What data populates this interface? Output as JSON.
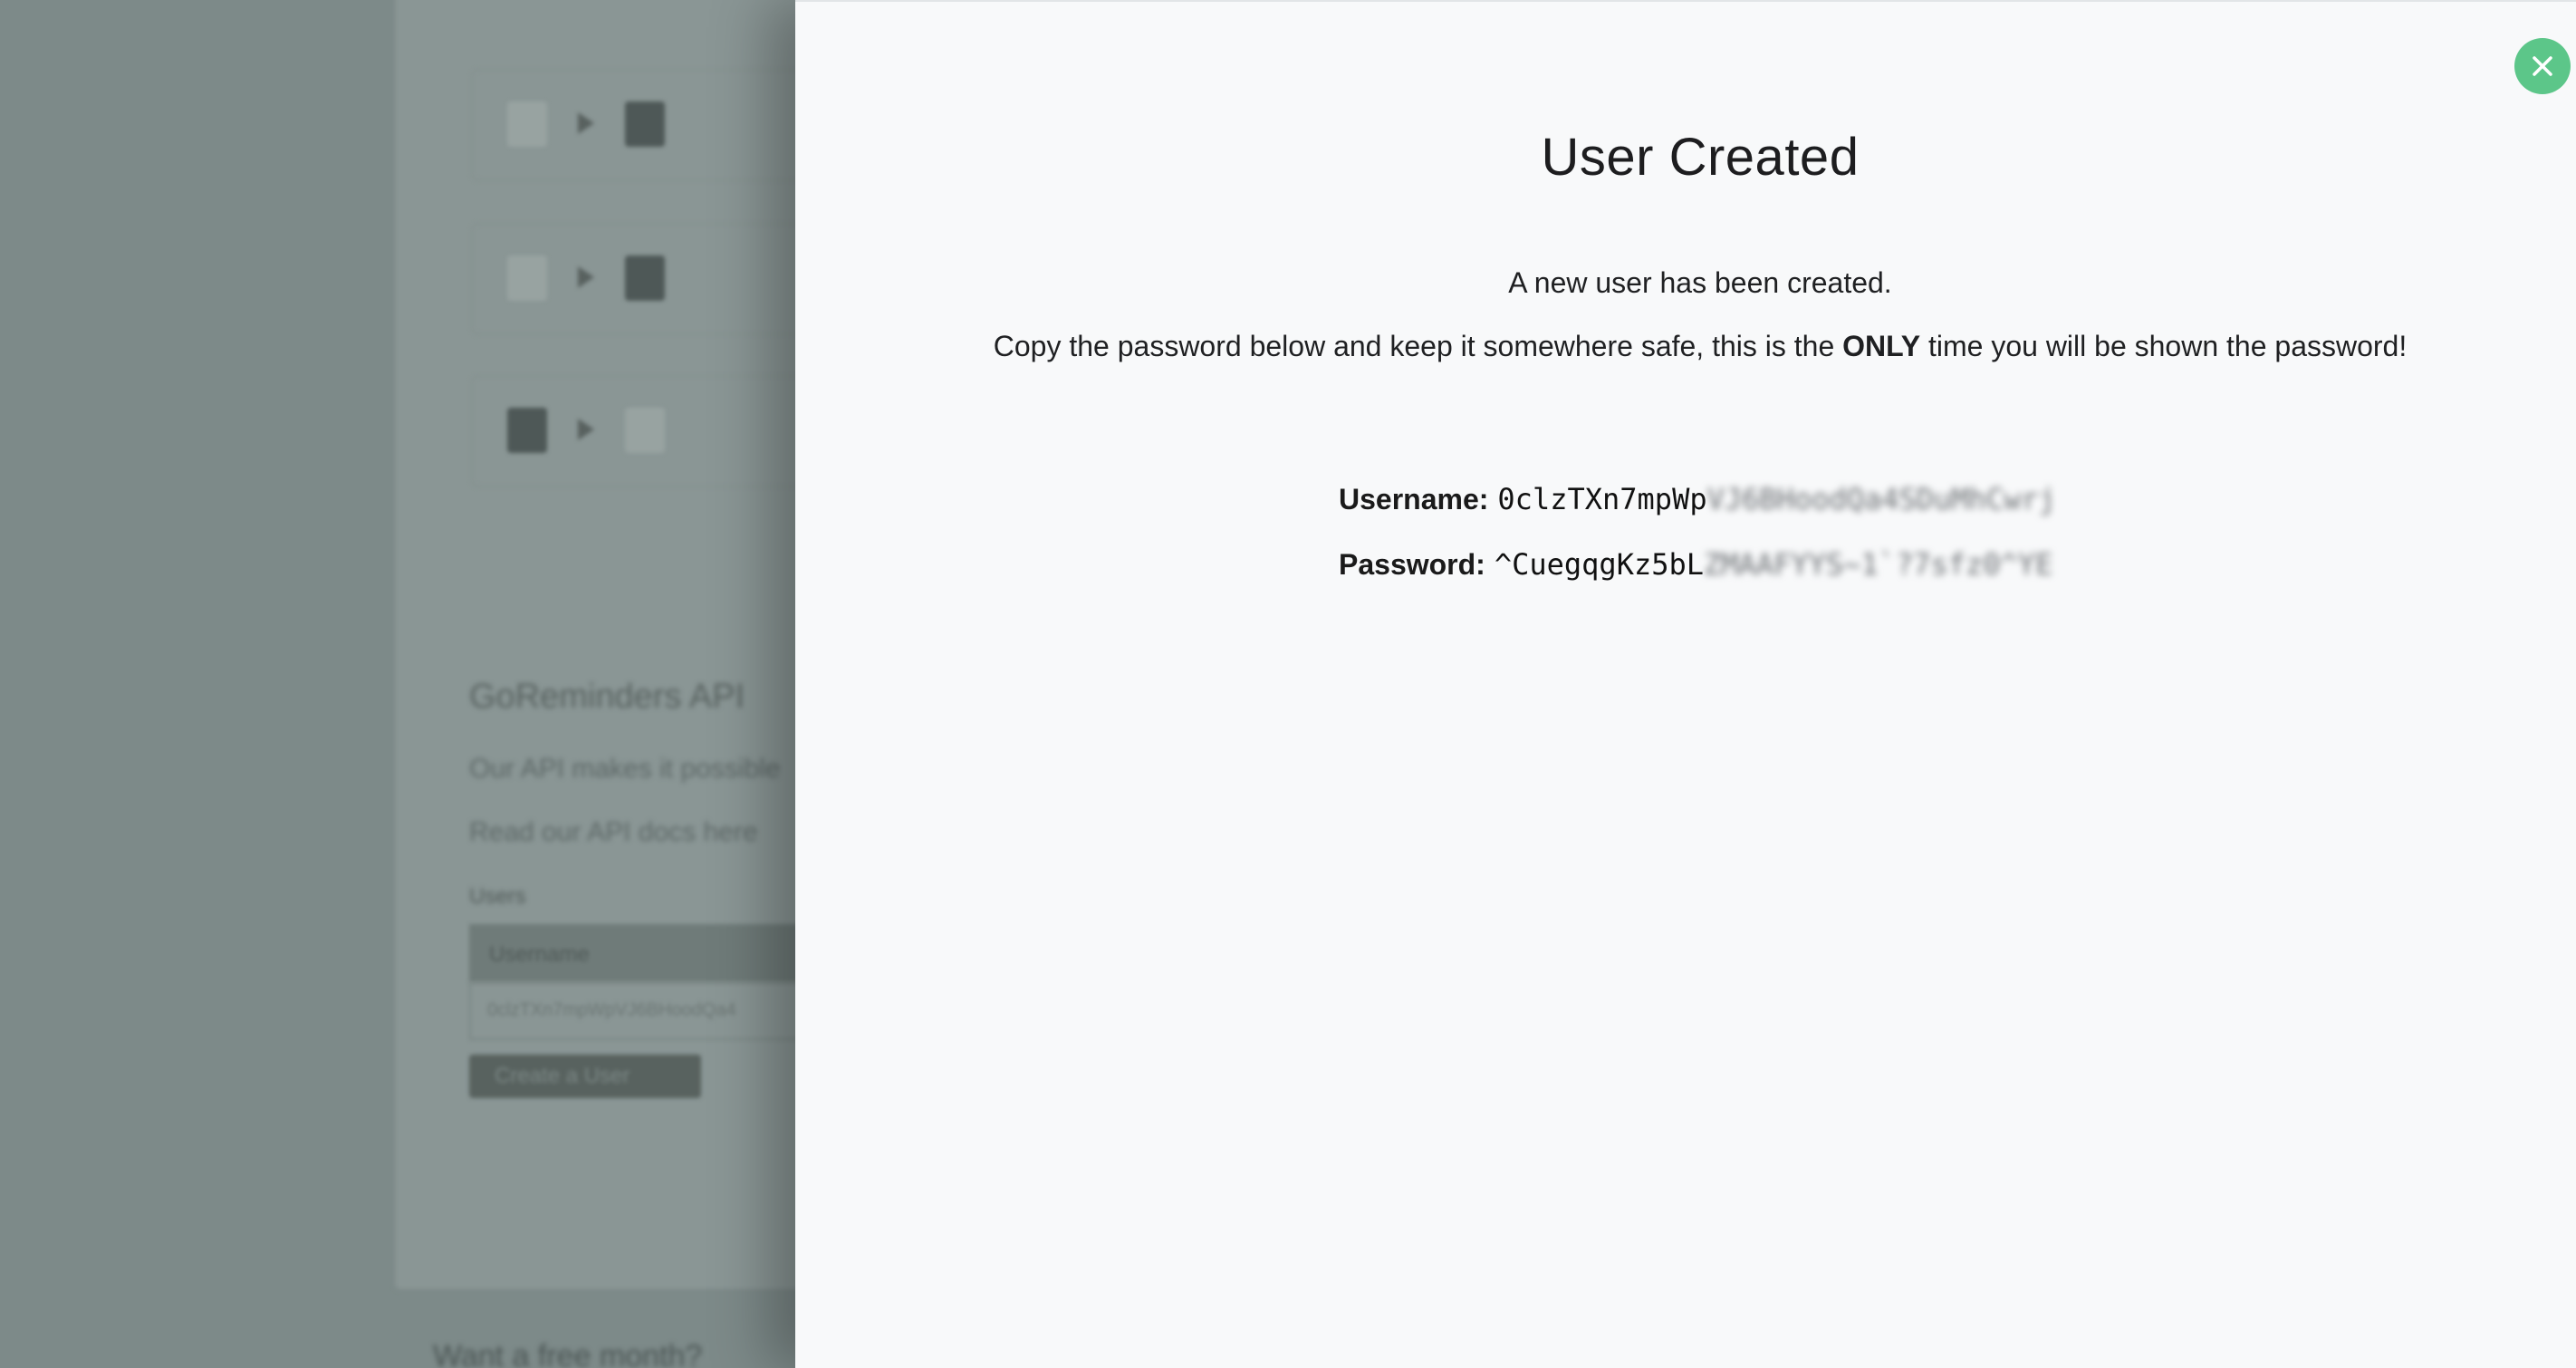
{
  "background": {
    "section_title": "GoReminders API",
    "paragraph_1": "Our API makes it possible",
    "paragraph_2": "Read our API docs here",
    "users_label": "Users",
    "table_header": "Username",
    "table_row_value": "0clzTXn7mpWpVJ6BHoodQa4",
    "create_button_label": "Create a User",
    "footer_text": "Want a free month?"
  },
  "modal": {
    "title": "User Created",
    "message_1": "A new user has been created.",
    "message_2_before": "Copy the password below and keep it somewhere safe, this is the ",
    "message_2_emphasis": "ONLY",
    "message_2_after": " time you will be shown the password!",
    "username_label": "Username:",
    "username_visible": "0clzTXn7mpWp",
    "username_hidden": "VJ6BHoodQa4SDuMhCwrj",
    "password_label": "Password:",
    "password_visible": "^CuegqgKz5bL",
    "password_hidden": "ZMAAFYYS~1`?7sfz0^YE",
    "close_icon": "close-icon",
    "accent_color": "#5cc689"
  }
}
